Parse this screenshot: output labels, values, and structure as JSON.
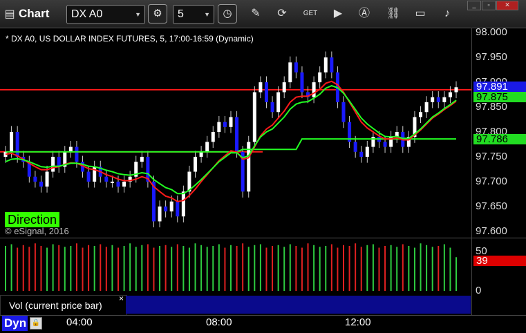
{
  "app": {
    "window_title": "Chart",
    "symbol": "DX A0",
    "interval": "5",
    "toolbar_icons": [
      "settings-icon",
      "clock-icon",
      "pencil-icon",
      "refresh-icon",
      "get-icon",
      "play-icon",
      "analytics-icon",
      "link-icon",
      "comment-icon",
      "twitter-icon"
    ]
  },
  "chart": {
    "description": "* DX A0, US DOLLAR INDEX FUTURES, 5, 17:00-16:59 (Dynamic)",
    "copyright": "© eSignal, 2016",
    "direction_label": "Direction",
    "price_ticks": [
      "98.000",
      "97.950",
      "97.900",
      "97.850",
      "97.800",
      "97.750",
      "97.700",
      "97.650",
      "97.600"
    ],
    "last_price": "97.891",
    "ma_fast_value": "97.875",
    "ma_slow_value": "97.786",
    "colors": {
      "up": "#ffffff",
      "down": "#1a1aff",
      "ma_red": "#ff1a1a",
      "ma_green": "#22ff22",
      "hline": "#ff1a1a",
      "last_tag": "#1a1ae6",
      "ma_tag": "#22dd22"
    }
  },
  "volume": {
    "title": "Vol (current price bar)",
    "close_symbol": "×",
    "ticks": [
      "50",
      "0"
    ],
    "current_value": "39"
  },
  "bottom": {
    "mode_label": "Dyn",
    "time_labels": [
      "04:00",
      "08:00",
      "12:00"
    ]
  },
  "chart_data": {
    "type": "candlestick",
    "x_range": [
      "00:30",
      "14:05"
    ],
    "ylim": [
      97.59,
      98.01
    ],
    "series": [
      {
        "name": "price_close",
        "values": [
          97.76,
          97.8,
          97.75,
          97.74,
          97.71,
          97.7,
          97.69,
          97.72,
          97.75,
          97.73,
          97.76,
          97.77,
          97.74,
          97.72,
          97.7,
          97.73,
          97.71,
          97.7,
          97.7,
          97.69,
          97.7,
          97.71,
          97.74,
          97.75,
          97.7,
          97.62,
          97.65,
          97.64,
          97.66,
          97.63,
          97.68,
          97.72,
          97.75,
          97.76,
          97.78,
          97.8,
          97.82,
          97.81,
          97.83,
          97.76,
          97.68,
          97.78,
          97.88,
          97.9,
          97.86,
          97.84,
          97.88,
          97.9,
          97.94,
          97.92,
          97.88,
          97.87,
          97.9,
          97.92,
          97.95,
          97.92,
          97.86,
          97.82,
          97.78,
          97.76,
          97.75,
          97.77,
          97.79,
          97.78,
          97.77,
          97.79,
          97.8,
          97.77,
          97.79,
          97.83,
          97.84,
          97.86,
          97.87,
          97.86,
          97.87,
          97.88,
          97.89
        ]
      },
      {
        "name": "ma_red",
        "values": [
          97.755,
          97.757,
          97.752,
          97.745,
          97.737,
          97.73,
          97.724,
          97.724,
          97.728,
          97.73,
          97.735,
          97.738,
          97.737,
          97.732,
          97.726,
          97.724,
          97.72,
          97.714,
          97.71,
          97.705,
          97.702,
          97.702,
          97.705,
          97.71,
          97.706,
          97.69,
          97.68,
          97.671,
          97.667,
          97.66,
          97.662,
          97.672,
          97.685,
          97.7,
          97.714,
          97.728,
          97.742,
          97.752,
          97.762,
          97.76,
          97.745,
          97.748,
          97.77,
          97.792,
          97.806,
          97.814,
          97.828,
          97.842,
          97.86,
          97.87,
          97.872,
          97.872,
          97.878,
          97.886,
          97.898,
          97.902,
          97.895,
          97.88,
          97.86,
          97.84,
          97.82,
          97.808,
          97.8,
          97.792,
          97.786,
          97.786,
          97.788,
          97.784,
          97.784,
          97.794,
          97.804,
          97.816,
          97.828,
          97.836,
          97.845,
          97.853,
          97.862
        ]
      },
      {
        "name": "ma_green",
        "values": [
          97.74,
          97.745,
          97.746,
          97.744,
          97.74,
          97.735,
          97.73,
          97.729,
          97.731,
          97.731,
          97.734,
          97.737,
          97.737,
          97.735,
          97.731,
          97.73,
          97.727,
          97.723,
          97.72,
          97.716,
          97.714,
          97.713,
          97.715,
          97.718,
          97.716,
          97.704,
          97.696,
          97.688,
          97.684,
          97.676,
          97.676,
          97.683,
          97.693,
          97.704,
          97.716,
          97.728,
          97.74,
          97.749,
          97.758,
          97.758,
          97.748,
          97.752,
          97.772,
          97.79,
          97.8,
          97.806,
          97.818,
          97.83,
          97.846,
          97.856,
          97.86,
          97.861,
          97.868,
          97.876,
          97.888,
          97.893,
          97.889,
          97.878,
          97.862,
          97.845,
          97.828,
          97.816,
          97.807,
          97.798,
          97.791,
          97.79,
          97.791,
          97.787,
          97.787,
          97.796,
          97.806,
          97.818,
          97.83,
          97.838,
          97.847,
          97.855,
          97.864
        ]
      },
      {
        "name": "hline_upper",
        "values": [
          97.885
        ]
      },
      {
        "name": "hline_lower",
        "values": [
          97.76
        ]
      },
      {
        "name": "ma_step",
        "values": [
          97.76,
          97.76,
          97.76,
          97.76,
          97.76,
          97.76,
          97.76,
          97.76,
          97.76,
          97.76,
          97.76,
          97.76,
          97.76,
          97.76,
          97.76,
          97.76,
          97.76,
          97.76,
          97.76,
          97.76,
          97.76,
          97.76,
          97.76,
          97.76,
          97.76,
          97.76,
          97.76,
          97.76,
          97.76,
          97.76,
          97.76,
          97.76,
          97.76,
          97.76,
          97.76,
          97.76,
          97.76,
          97.76,
          97.76,
          97.76,
          97.765,
          97.765,
          97.765,
          97.765,
          97.765,
          97.765,
          97.765,
          97.765,
          97.765,
          97.765,
          97.786,
          97.786,
          97.786,
          97.786,
          97.786,
          97.786,
          97.786,
          97.786,
          97.786,
          97.786,
          97.786,
          97.786,
          97.786,
          97.786,
          97.786,
          97.786,
          97.786,
          97.786,
          97.786,
          97.786,
          97.786,
          97.786,
          97.786,
          97.786,
          97.786,
          97.786,
          97.786
        ]
      }
    ],
    "volume_ylim": [
      0,
      60
    ],
    "volume_values": [
      52,
      54,
      50,
      53,
      51,
      55,
      52,
      50,
      54,
      53,
      51,
      52,
      55,
      50,
      53,
      52,
      54,
      51,
      53,
      50,
      52,
      55,
      51,
      53,
      54,
      50,
      52,
      53,
      51,
      54,
      52,
      50,
      55,
      53,
      51,
      52,
      54,
      50,
      53,
      52,
      55,
      51,
      53,
      54,
      50,
      52,
      53,
      51,
      54,
      52,
      50,
      55,
      53,
      51,
      52,
      54,
      50,
      53,
      52,
      55,
      51,
      53,
      54,
      50,
      52,
      53,
      51,
      54,
      52,
      50,
      55,
      53,
      51,
      52,
      54,
      50,
      39
    ]
  }
}
